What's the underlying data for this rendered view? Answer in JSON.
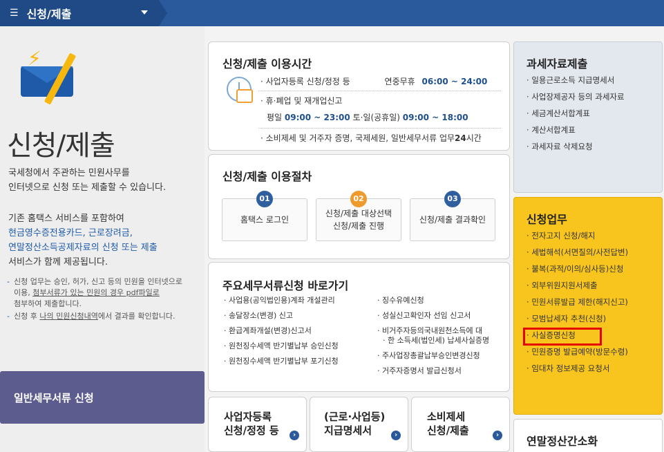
{
  "topbar": {
    "menu_icon": "menu-icon",
    "title": "신청/제출"
  },
  "left": {
    "big_title": "신청/제출",
    "desc1_line1": "국세청에서 주관하는 민원사무를",
    "desc1_line2": "인터넷으로 신청 또는 제출할 수 있습니다.",
    "desc2_line1": "기존 홈택스 서비스를 포함하여",
    "desc2_line2": "현금영수증전용카드, 근로장려금,",
    "desc2_line3": "연말정산소득공제자료의 신청 또는 제출",
    "desc2_line4": "서비스가 함께 제공됩니다.",
    "note1_a": "신청 업무는 승인, 허가, 신고 등의 민원을 인터넷으로",
    "note1_b": "이용, ",
    "note1_c": "첨부서류가 있는 민원의 경우 pdf파일로",
    "note1_d": "첨부하여 제출합니다.",
    "note2_a": "신청 후 ",
    "note2_b": "나의 민원신청내역",
    "note2_c": "에서 결과를 확인합니다.",
    "general_btn": "일반세무서류 신청"
  },
  "hours": {
    "title": "신청/제출 이용시간",
    "r1_label": "· 사업자등록 신청/정정 등",
    "r1_time_label": "연중무휴",
    "r1_time": "06:00 ~ 24:00",
    "r2_label": "· 휴·폐업 및 재개업신고",
    "r3_a": "평일",
    "r3_b": "09:00 ~ 23:00",
    "r3_c": "토·일(공휴일)",
    "r3_d": "09:00 ~ 18:00",
    "r4_a": "· 소비제세 및 거주자 증명, 국제세원, 일반세무서류 업무",
    "r4_b": "24",
    "r4_c": "시간"
  },
  "proc": {
    "title": "신청/제출 이용절차",
    "steps": [
      {
        "num": "01",
        "l1": "홈택스 로그인",
        "l2": ""
      },
      {
        "num": "02",
        "l1": "신청/제출 대상선택",
        "l2": "신청/제출 진행"
      },
      {
        "num": "03",
        "l1": "신청/제출 결과확인",
        "l2": ""
      }
    ]
  },
  "quick": {
    "title": "주요세무서류신청 바로가기",
    "left": [
      "사업용(공익법인용)계좌 개설관리",
      "송달장소(변경) 신고",
      "환급계좌개설(변경)신고서",
      "원천징수세액 반기별납부 승인신청",
      "원천징수세액 반기별납부 포기신청"
    ],
    "right": [
      "징수유예신청",
      "성실신고확인자 선임 신고서",
      "비거주자등의국내원천소득에 대",
      "한 소득세(법인세) 납세사실증명",
      "주사업장총괄납부승인변경신청",
      "거주자증명서 발급신청서"
    ]
  },
  "bottom": [
    {
      "l1": "사업자등록",
      "l2": "신청/정정 등"
    },
    {
      "l1": "(근로·사업등)",
      "l2": "지급명세서"
    },
    {
      "l1": "소비제세",
      "l2": "신청/제출"
    }
  ],
  "go_glyph": "›",
  "right_gray": {
    "title": "과세자료제출",
    "items": [
      "일용근로소득 지급명세서",
      "사업장제공자 등의 과세자료",
      "세금계산서합계표",
      "계산서합계표",
      "과세자료 삭제요청"
    ]
  },
  "right_yellow": {
    "title": "신청업무",
    "items": [
      "전자고지 신청/해지",
      "세법해석(서면질의/사전답변)",
      "불복(과적/이의/심사등)신청",
      "외부위원지원서제출",
      "민원서류발급 제한(해지신고)",
      "모범납세자 추천(신청)",
      "사실증명신청",
      "민원증명 발급예약(방문수령)",
      "임대차 정보제공 요청서"
    ],
    "highlight_color": "#e60000"
  },
  "right_white": {
    "title": "연말정산간소화"
  }
}
